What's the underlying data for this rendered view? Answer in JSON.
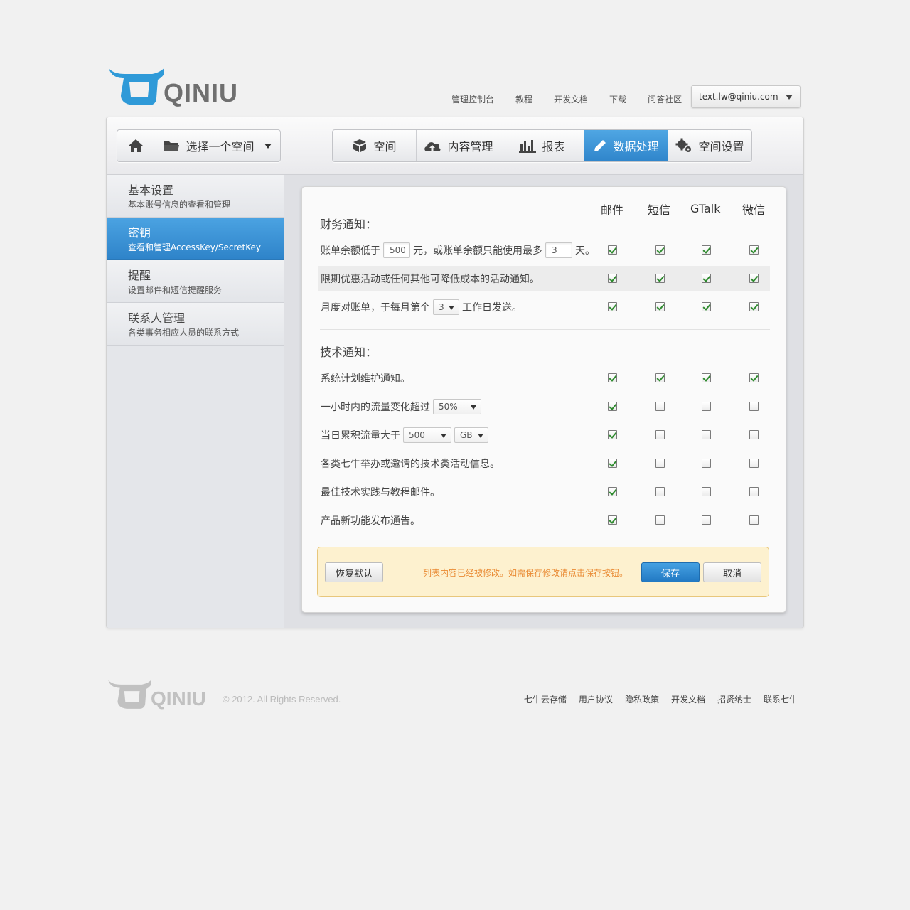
{
  "brand": {
    "logo_text": "QINIU",
    "color": "#2f9ad8"
  },
  "topnav": [
    "管理控制台",
    "教程",
    "开发文档",
    "下载",
    "问答社区"
  ],
  "user": {
    "email": "text.lw@qiniu.com"
  },
  "toolbar": {
    "home_icon": "home-icon",
    "space_select": "选择一个空间",
    "tabs": [
      {
        "label": "空间",
        "icon": "box-icon"
      },
      {
        "label": "内容管理",
        "icon": "cloud-upload-icon"
      },
      {
        "label": "报表",
        "icon": "bar-chart-icon"
      },
      {
        "label": "数据处理",
        "icon": "pencil-icon"
      },
      {
        "label": "空间设置",
        "icon": "gears-icon"
      }
    ],
    "active_tab": "数据处理"
  },
  "sidebar": [
    {
      "title": "基本设置",
      "sub": "基本账号信息的查看和管理"
    },
    {
      "title": "密钥",
      "sub": "查看和管理AccessKey/SecretKey"
    },
    {
      "title": "提醒",
      "sub": "设置邮件和短信提醒服务"
    },
    {
      "title": "联系人管理",
      "sub": "各类事务相应人员的联系方式"
    }
  ],
  "columns": [
    "邮件",
    "短信",
    "GTalk",
    "微信"
  ],
  "finance": {
    "title": "财务通知：",
    "row1": {
      "pre": "账单余额低于",
      "amount": "500",
      "mid": "元，或账单余额只能使用最多",
      "days": "3",
      "post": "天。",
      "checks": [
        true,
        true,
        true,
        true
      ]
    },
    "row2": {
      "text": "限期优惠活动或任何其他可降低成本的活动通知。",
      "checks": [
        true,
        true,
        true,
        true
      ]
    },
    "row3": {
      "pre": "月度对账单，于每月第个",
      "day": "3",
      "post": "工作日发送。",
      "checks": [
        true,
        true,
        true,
        true
      ]
    }
  },
  "tech": {
    "title": "技术通知：",
    "row1": {
      "text": "系统计划维护通知。",
      "checks": [
        true,
        true,
        true,
        true
      ]
    },
    "row2": {
      "pre": "一小时内的流量变化超过",
      "pct": "50%",
      "checks": [
        true,
        false,
        false,
        false
      ]
    },
    "row3": {
      "pre": "当日累积流量大于",
      "amount": "500",
      "unit": "GB",
      "checks": [
        true,
        false,
        false,
        false
      ]
    },
    "row4": {
      "text": "各类七牛举办或邀请的技术类活动信息。",
      "checks": [
        true,
        false,
        false,
        false
      ]
    },
    "row5": {
      "text": "最佳技术实践与教程邮件。",
      "checks": [
        true,
        false,
        false,
        false
      ]
    },
    "row6": {
      "text": "产品新功能发布通告。",
      "checks": [
        true,
        false,
        false,
        false
      ]
    }
  },
  "actions": {
    "reset": "恢复默认",
    "message": "列表内容已经被修改。如需保存修改请点击保存按钮。",
    "save": "保存",
    "cancel": "取消"
  },
  "footer": {
    "logo_text": "QINIU",
    "copyright": "© 2012. All Rights Reserved.",
    "links": [
      "七牛云存储",
      "用户协议",
      "隐私政策",
      "开发文档",
      "招贤纳士",
      "联系七牛"
    ]
  }
}
